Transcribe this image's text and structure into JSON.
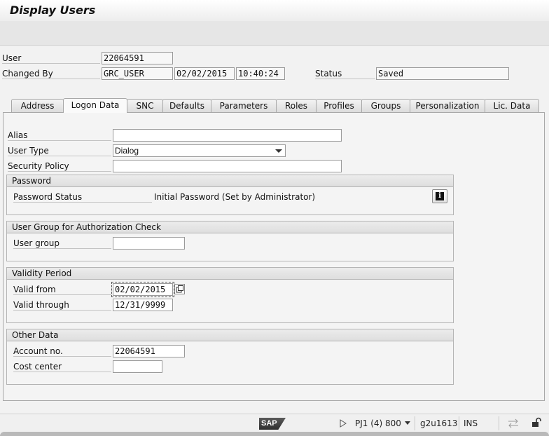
{
  "window": {
    "title": "Display Users"
  },
  "header": {
    "user_label": "User",
    "user_value": "22064591",
    "changed_by_label": "Changed By",
    "changed_by_value": "GRC_USER",
    "changed_date": "02/02/2015",
    "changed_time": "10:40:24",
    "status_label": "Status",
    "status_value": "Saved"
  },
  "tabs": [
    {
      "label": "Address"
    },
    {
      "label": "Logon Data",
      "active": true
    },
    {
      "label": "SNC"
    },
    {
      "label": "Defaults"
    },
    {
      "label": "Parameters"
    },
    {
      "label": "Roles"
    },
    {
      "label": "Profiles"
    },
    {
      "label": "Groups"
    },
    {
      "label": "Personalization"
    },
    {
      "label": "Lic. Data"
    }
  ],
  "logon": {
    "alias_label": "Alias",
    "alias_value": "",
    "user_type_label": "User Type",
    "user_type_value": "Dialog",
    "security_policy_label": "Security Policy",
    "security_policy_value": ""
  },
  "password_group": {
    "title": "Password",
    "status_label": "Password Status",
    "status_value": "Initial Password (Set by Administrator)",
    "info_icon": "info-icon"
  },
  "auth_group": {
    "title": "User Group for Authorization Check",
    "user_group_label": "User group",
    "user_group_value": ""
  },
  "validity_group": {
    "title": "Validity Period",
    "valid_from_label": "Valid from",
    "valid_from_value": "02/02/2015",
    "valid_through_label": "Valid through",
    "valid_through_value": "12/31/9999"
  },
  "other_group": {
    "title": "Other Data",
    "account_label": "Account no.",
    "account_value": "22064591",
    "cost_center_label": "Cost center",
    "cost_center_value": ""
  },
  "statusbar": {
    "logo": "SAP",
    "system": "PJ1 (4) 800",
    "server": "g2u1613",
    "mode": "INS"
  }
}
